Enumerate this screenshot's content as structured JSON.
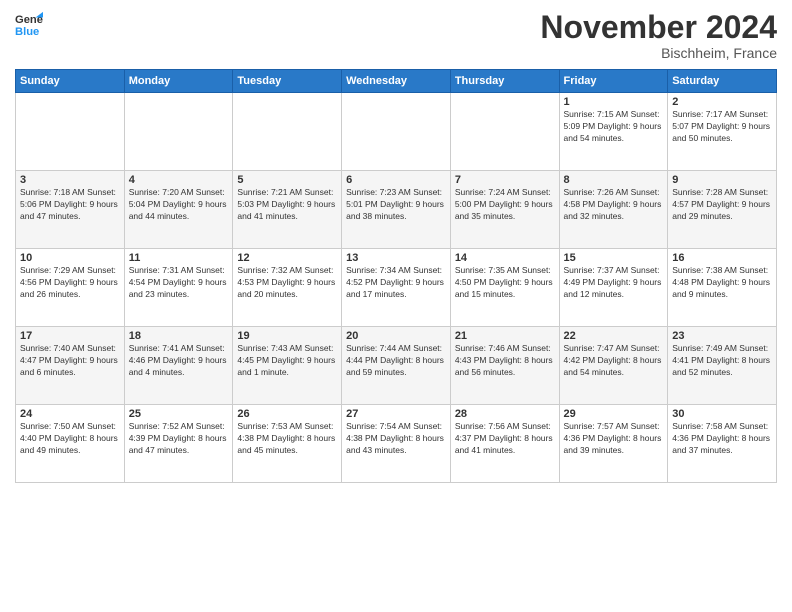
{
  "header": {
    "logo_general": "General",
    "logo_blue": "Blue",
    "month_title": "November 2024",
    "location": "Bischheim, France"
  },
  "days_of_week": [
    "Sunday",
    "Monday",
    "Tuesday",
    "Wednesday",
    "Thursday",
    "Friday",
    "Saturday"
  ],
  "weeks": [
    [
      {
        "day": "",
        "info": ""
      },
      {
        "day": "",
        "info": ""
      },
      {
        "day": "",
        "info": ""
      },
      {
        "day": "",
        "info": ""
      },
      {
        "day": "",
        "info": ""
      },
      {
        "day": "1",
        "info": "Sunrise: 7:15 AM\nSunset: 5:09 PM\nDaylight: 9 hours\nand 54 minutes."
      },
      {
        "day": "2",
        "info": "Sunrise: 7:17 AM\nSunset: 5:07 PM\nDaylight: 9 hours\nand 50 minutes."
      }
    ],
    [
      {
        "day": "3",
        "info": "Sunrise: 7:18 AM\nSunset: 5:06 PM\nDaylight: 9 hours\nand 47 minutes."
      },
      {
        "day": "4",
        "info": "Sunrise: 7:20 AM\nSunset: 5:04 PM\nDaylight: 9 hours\nand 44 minutes."
      },
      {
        "day": "5",
        "info": "Sunrise: 7:21 AM\nSunset: 5:03 PM\nDaylight: 9 hours\nand 41 minutes."
      },
      {
        "day": "6",
        "info": "Sunrise: 7:23 AM\nSunset: 5:01 PM\nDaylight: 9 hours\nand 38 minutes."
      },
      {
        "day": "7",
        "info": "Sunrise: 7:24 AM\nSunset: 5:00 PM\nDaylight: 9 hours\nand 35 minutes."
      },
      {
        "day": "8",
        "info": "Sunrise: 7:26 AM\nSunset: 4:58 PM\nDaylight: 9 hours\nand 32 minutes."
      },
      {
        "day": "9",
        "info": "Sunrise: 7:28 AM\nSunset: 4:57 PM\nDaylight: 9 hours\nand 29 minutes."
      }
    ],
    [
      {
        "day": "10",
        "info": "Sunrise: 7:29 AM\nSunset: 4:56 PM\nDaylight: 9 hours\nand 26 minutes."
      },
      {
        "day": "11",
        "info": "Sunrise: 7:31 AM\nSunset: 4:54 PM\nDaylight: 9 hours\nand 23 minutes."
      },
      {
        "day": "12",
        "info": "Sunrise: 7:32 AM\nSunset: 4:53 PM\nDaylight: 9 hours\nand 20 minutes."
      },
      {
        "day": "13",
        "info": "Sunrise: 7:34 AM\nSunset: 4:52 PM\nDaylight: 9 hours\nand 17 minutes."
      },
      {
        "day": "14",
        "info": "Sunrise: 7:35 AM\nSunset: 4:50 PM\nDaylight: 9 hours\nand 15 minutes."
      },
      {
        "day": "15",
        "info": "Sunrise: 7:37 AM\nSunset: 4:49 PM\nDaylight: 9 hours\nand 12 minutes."
      },
      {
        "day": "16",
        "info": "Sunrise: 7:38 AM\nSunset: 4:48 PM\nDaylight: 9 hours\nand 9 minutes."
      }
    ],
    [
      {
        "day": "17",
        "info": "Sunrise: 7:40 AM\nSunset: 4:47 PM\nDaylight: 9 hours\nand 6 minutes."
      },
      {
        "day": "18",
        "info": "Sunrise: 7:41 AM\nSunset: 4:46 PM\nDaylight: 9 hours\nand 4 minutes."
      },
      {
        "day": "19",
        "info": "Sunrise: 7:43 AM\nSunset: 4:45 PM\nDaylight: 9 hours\nand 1 minute."
      },
      {
        "day": "20",
        "info": "Sunrise: 7:44 AM\nSunset: 4:44 PM\nDaylight: 8 hours\nand 59 minutes."
      },
      {
        "day": "21",
        "info": "Sunrise: 7:46 AM\nSunset: 4:43 PM\nDaylight: 8 hours\nand 56 minutes."
      },
      {
        "day": "22",
        "info": "Sunrise: 7:47 AM\nSunset: 4:42 PM\nDaylight: 8 hours\nand 54 minutes."
      },
      {
        "day": "23",
        "info": "Sunrise: 7:49 AM\nSunset: 4:41 PM\nDaylight: 8 hours\nand 52 minutes."
      }
    ],
    [
      {
        "day": "24",
        "info": "Sunrise: 7:50 AM\nSunset: 4:40 PM\nDaylight: 8 hours\nand 49 minutes."
      },
      {
        "day": "25",
        "info": "Sunrise: 7:52 AM\nSunset: 4:39 PM\nDaylight: 8 hours\nand 47 minutes."
      },
      {
        "day": "26",
        "info": "Sunrise: 7:53 AM\nSunset: 4:38 PM\nDaylight: 8 hours\nand 45 minutes."
      },
      {
        "day": "27",
        "info": "Sunrise: 7:54 AM\nSunset: 4:38 PM\nDaylight: 8 hours\nand 43 minutes."
      },
      {
        "day": "28",
        "info": "Sunrise: 7:56 AM\nSunset: 4:37 PM\nDaylight: 8 hours\nand 41 minutes."
      },
      {
        "day": "29",
        "info": "Sunrise: 7:57 AM\nSunset: 4:36 PM\nDaylight: 8 hours\nand 39 minutes."
      },
      {
        "day": "30",
        "info": "Sunrise: 7:58 AM\nSunset: 4:36 PM\nDaylight: 8 hours\nand 37 minutes."
      }
    ]
  ]
}
